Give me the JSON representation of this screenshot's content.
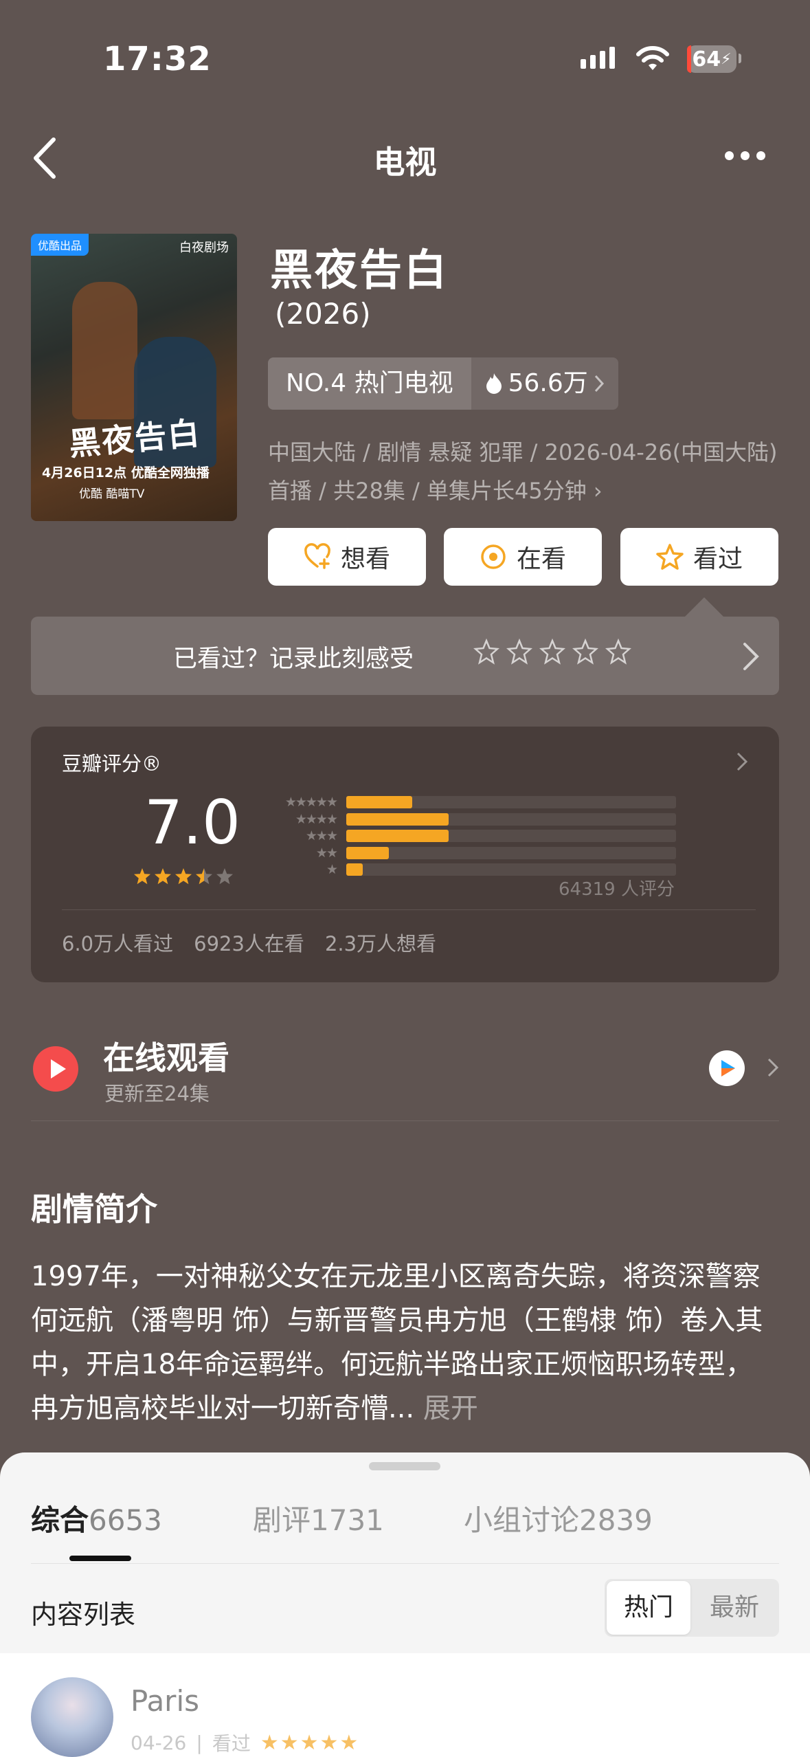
{
  "status_bar": {
    "time": "17:32",
    "battery": "64"
  },
  "nav": {
    "title": "电视"
  },
  "poster": {
    "badge": "优酷出品",
    "studio": "白夜剧场",
    "title_art": "黑夜告白",
    "date_line": "4月26日12点 优酷全网独播",
    "platforms": "优酷  酷喵TV"
  },
  "show": {
    "title": "黑夜告白",
    "year": "(2026)",
    "rank": "NO.4 热门电视",
    "heat": "56.6万",
    "meta": "中国大陆 / 剧情 悬疑 犯罪 / 2026-04-26(中国大陆) 首播 / 共28集 / 单集片长45分钟"
  },
  "actions": {
    "want": "想看",
    "watching": "在看",
    "watched": "看过"
  },
  "record": {
    "prompt": "已看过？记录此刻感受"
  },
  "rating": {
    "label": "豆瓣评分®",
    "score": "7.0",
    "stars_value": 3.5,
    "distribution": [
      {
        "stars": "★★★★★",
        "fraction": 0.2
      },
      {
        "stars": "★★★★",
        "fraction": 0.31
      },
      {
        "stars": "★★★",
        "fraction": 0.31
      },
      {
        "stars": "★★",
        "fraction": 0.13
      },
      {
        "stars": "★",
        "fraction": 0.05
      }
    ],
    "count": "64319 人评分",
    "stats": {
      "watched": "6.0万人看过",
      "watching": "6923人在看",
      "want": "2.3万人想看"
    }
  },
  "watch": {
    "title": "在线观看",
    "subtitle": "更新至24集"
  },
  "synopsis": {
    "title": "剧情简介",
    "text": "1997年，一对神秘父女在元龙里小区离奇失踪，将资深警察何远航（潘粤明 饰）与新晋警员冉方旭（王鹤棣 饰）卷入其中，开启18年命运羁绊。何远航半路出家正烦恼职场转型，冉方旭高校毕业对一切新奇懵...",
    "more": "展开"
  },
  "sheet": {
    "tabs": [
      {
        "label": "综合",
        "count": "6653"
      },
      {
        "label": "剧评",
        "count": "1731"
      },
      {
        "label": "小组讨论",
        "count": "2839"
      }
    ],
    "list_label": "内容列表",
    "sort_hot": "热门",
    "sort_new": "最新"
  },
  "review": {
    "name": "Paris",
    "date": "04-26",
    "status": "看过",
    "stars": "★★★★★"
  },
  "colors": {
    "background": "#5f5451",
    "accent_star": "#f5a623",
    "play_red": "#f44c4c"
  }
}
